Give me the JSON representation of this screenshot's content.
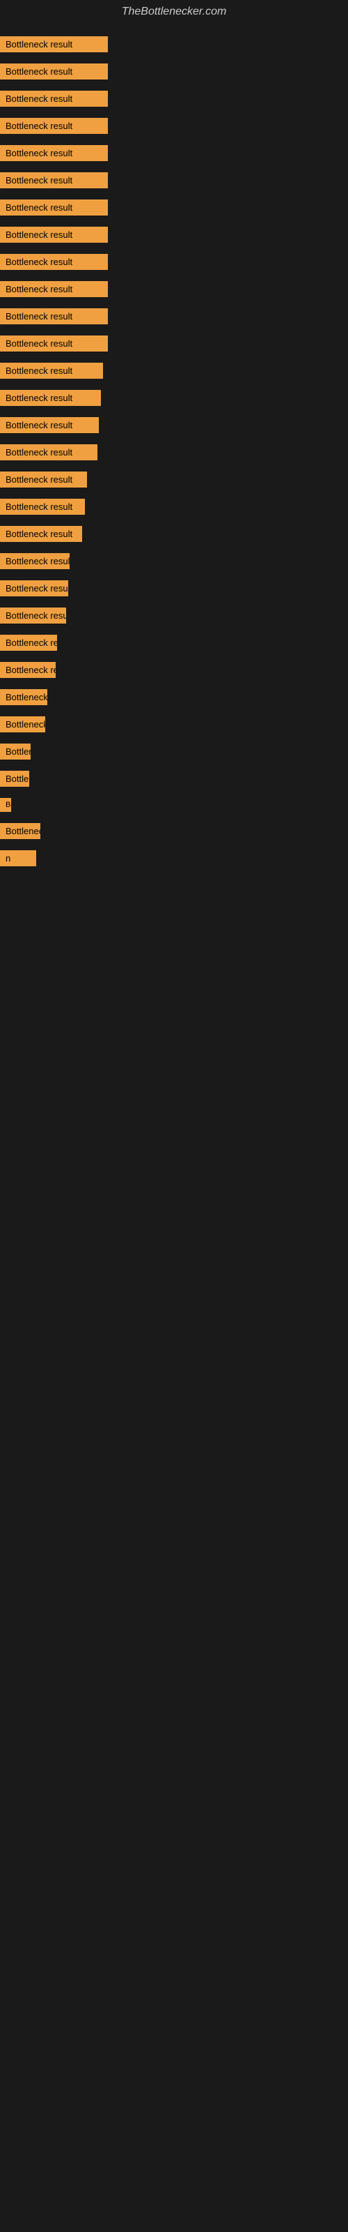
{
  "site": {
    "title": "TheBottlenecker.com"
  },
  "items": [
    {
      "label": "Bottleneck result",
      "badge_class": "badge-full",
      "id": 1
    },
    {
      "label": "Bottleneck result",
      "badge_class": "badge-full",
      "id": 2
    },
    {
      "label": "Bottleneck result",
      "badge_class": "badge-full",
      "id": 3
    },
    {
      "label": "Bottleneck result",
      "badge_class": "badge-full",
      "id": 4
    },
    {
      "label": "Bottleneck result",
      "badge_class": "badge-full",
      "id": 5
    },
    {
      "label": "Bottleneck result",
      "badge_class": "badge-full",
      "id": 6
    },
    {
      "label": "Bottleneck result",
      "badge_class": "badge-full",
      "id": 7
    },
    {
      "label": "Bottleneck result",
      "badge_class": "badge-full",
      "id": 8
    },
    {
      "label": "Bottleneck result",
      "badge_class": "badge-full",
      "id": 9
    },
    {
      "label": "Bottleneck result",
      "badge_class": "badge-full",
      "id": 10
    },
    {
      "label": "Bottleneck result",
      "badge_class": "badge-full",
      "id": 11
    },
    {
      "label": "Bottleneck result",
      "badge_class": "badge-full",
      "id": 12
    },
    {
      "label": "Bottleneck result",
      "badge_class": "badge-large",
      "id": 13
    },
    {
      "label": "Bottleneck result",
      "badge_class": "badge-large",
      "id": 14
    },
    {
      "label": "Bottleneck result",
      "badge_class": "badge-large",
      "id": 15
    },
    {
      "label": "Bottleneck result",
      "badge_class": "badge-large",
      "id": 16
    },
    {
      "label": "Bottleneck result",
      "badge_class": "badge-medium",
      "id": 17
    },
    {
      "label": "Bottleneck result",
      "badge_class": "badge-medium",
      "id": 18
    },
    {
      "label": "Bottleneck result",
      "badge_class": "badge-medium",
      "id": 19
    },
    {
      "label": "Bottleneck result",
      "badge_class": "badge-small",
      "id": 20
    },
    {
      "label": "Bottleneck result",
      "badge_class": "badge-small",
      "id": 21
    },
    {
      "label": "Bottleneck result",
      "badge_class": "badge-small",
      "id": 22
    },
    {
      "label": "Bottleneck result",
      "badge_class": "badge-smaller",
      "id": 23
    },
    {
      "label": "Bottleneck result",
      "badge_class": "badge-smaller",
      "id": 24
    },
    {
      "label": "Bottleneck result",
      "badge_class": "badge-tiny",
      "id": 25
    },
    {
      "label": "Bottleneck result",
      "badge_class": "badge-tiny",
      "id": 26
    },
    {
      "label": "Bottleneck result",
      "badge_class": "badge-mini",
      "id": 27
    },
    {
      "label": "Bottleneck result",
      "badge_class": "badge-micro",
      "id": 28
    },
    {
      "label": "Bottleneck result",
      "badge_class": "badge-nano",
      "id": 29
    },
    {
      "label": "Bottleneck result",
      "badge_class": "badge-zepto",
      "id": 30
    },
    {
      "label": "n",
      "badge_class": "badge-femto",
      "id": 31
    }
  ],
  "colors": {
    "background": "#1a1a1a",
    "badge": "#f0a040",
    "title": "#cccccc"
  }
}
